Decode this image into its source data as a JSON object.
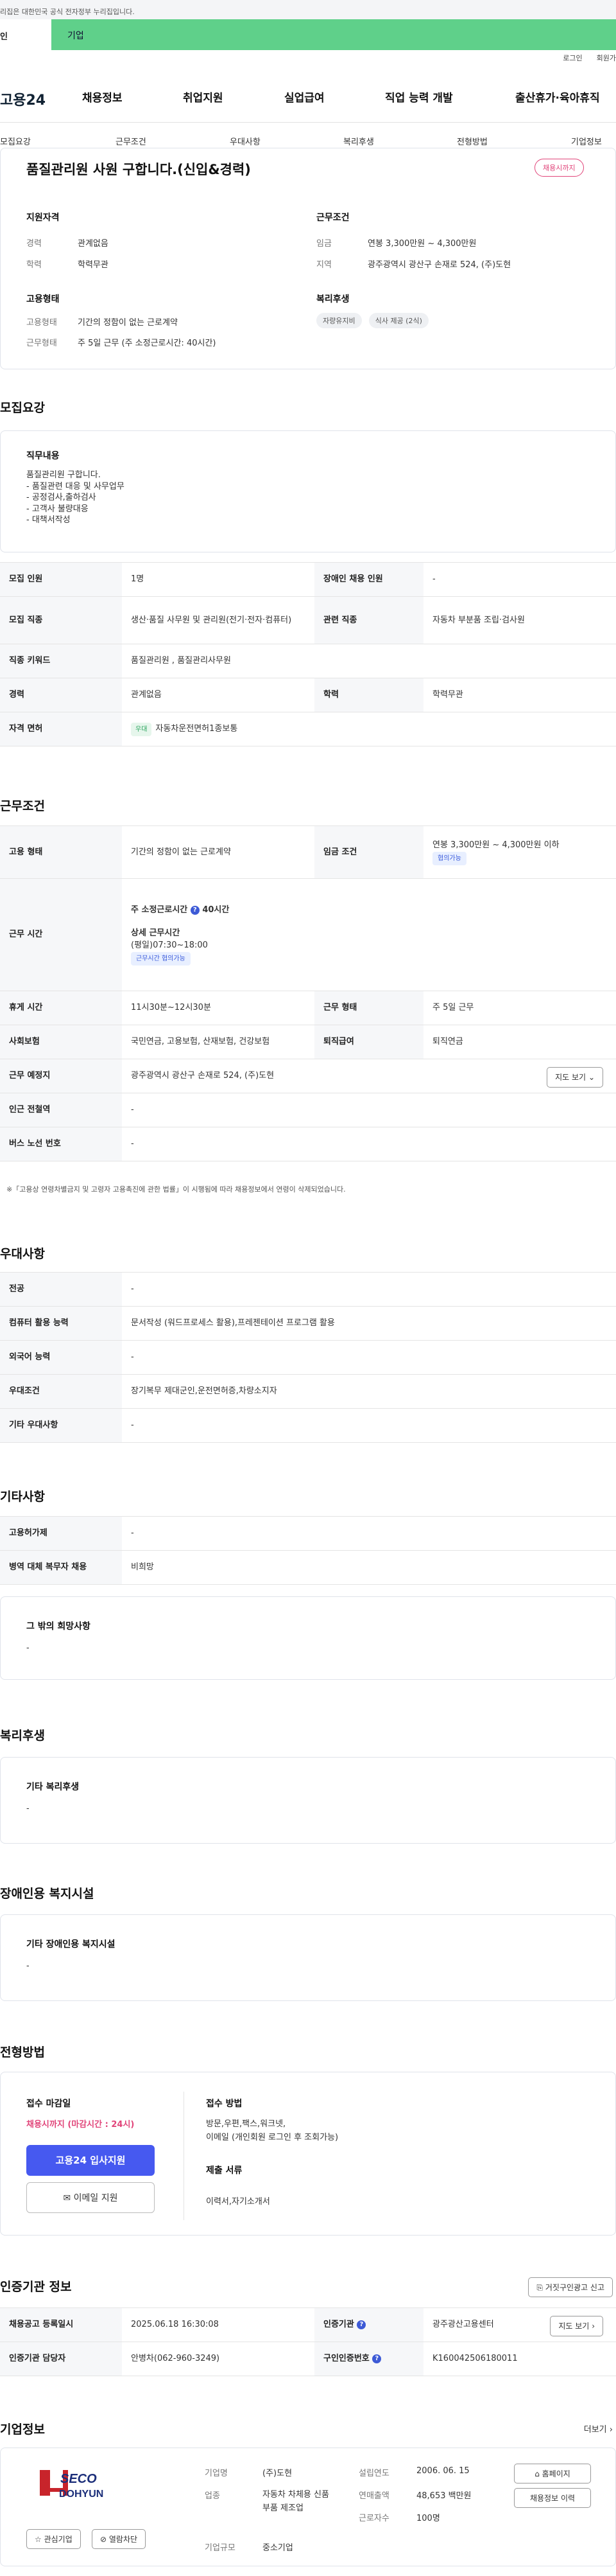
{
  "header": {
    "notice": "리집은 대한민국 공식 전자정부 누리집입니다.",
    "user_tab_personal": "인",
    "user_tab_company": "기업",
    "util_login": "로그인",
    "util_join": "회원가",
    "logo": "고용24",
    "gnb": [
      "채용정보",
      "취업지원",
      "실업급여",
      "직업 능력 개발",
      "출산휴가·육아휴직"
    ],
    "subnav": [
      "모집요강",
      "근무조건",
      "우대사항",
      "복리후생",
      "전형방법",
      "기업정보"
    ]
  },
  "summary": {
    "title": "품질관리원 사원 구합니다.(신입&경력)",
    "status_badge": "채용시까지",
    "qual_title": "지원자격",
    "career_label": "경력",
    "career_value": "관계없음",
    "edu_label": "학력",
    "edu_value": "학력무관",
    "cond_title": "근무조건",
    "wage_label": "임금",
    "wage_value": "연봉 3,300만원 ~ 4,300만원",
    "region_label": "지역",
    "region_value": "광주광역시 광산구 손재로 524, (주)도현",
    "emp_title": "고용형태",
    "emptype_label": "고용형태",
    "emptype_value": "기간의 정함이 없는 근로계약",
    "worktype_label": "근무형태",
    "worktype_value": "주 5일 근무 (주 소정근로시간: 40시간)",
    "welfare_title": "복리후생",
    "welfare_chips": [
      "자량유지비",
      "식사 제공 (2식)"
    ]
  },
  "recruit": {
    "title": "모집요강",
    "duty_title": "직무내용",
    "duty_text": "품질관리원 구합니다.\n - 품질관련 대응 및 사무업무\n - 공정검사,출하검사\n - 고객사 불량대응\n - 대책서작성",
    "rows": {
      "count_label": "모집 인원",
      "count_value": "1명",
      "disabled_label": "장애인 채용 인원",
      "disabled_value": "-",
      "job_label": "모집 직종",
      "job_value": "생산·품질 사무원 및 관리원(전기·전자·컴퓨터)",
      "rel_label": "관련 직종",
      "rel_value": "자동차 부분품 조립·검사원",
      "kw_label": "직종 키워드",
      "kw_value": "품질관리원 , 품질관리사무원",
      "career_label": "경력",
      "career_value": "관계없음",
      "edu_label": "학력",
      "edu_value": "학력무관",
      "license_label": "자격 면허",
      "license_chip": "우대",
      "license_value": "자동차운전면허1종보통"
    }
  },
  "conditions": {
    "title": "근무조건",
    "emptype_label": "고용 형태",
    "emptype_value": "기간의 정함이 없는 근로계약",
    "wage_label": "임금 조건",
    "wage_value": "연봉 3,300만원 ~ 4,300만원 이하",
    "wage_chip": "협의가능",
    "hours_label": "근무 시간",
    "hours_weekly": "주 소정근로시간",
    "hours_weekly_value": "40시간",
    "hours_detail_title": "상세 근무시간",
    "hours_detail": "(평일)07:30~18:00",
    "hours_chip": "근무시간 협의가능",
    "break_label": "휴게 시간",
    "break_value": "11시30분~12시30분",
    "worktype_label": "근무 형태",
    "worktype_value": "주 5일 근무",
    "insurance_label": "사회보험",
    "insurance_value": "국민연금, 고용보험, 산재보험, 건강보험",
    "retire_label": "퇴직급여",
    "retire_value": "퇴직연금",
    "place_label": "근무 예정지",
    "place_value": "광주광역시 광산구 손재로 524, (주)도현",
    "map_btn": "지도 보기",
    "subway_label": "인근 전철역",
    "subway_value": "-",
    "bus_label": "버스 노선 번호",
    "bus_value": "-",
    "footnote": "※「고용상 연령차별금지 및 고령자 고용촉진에 관한 법률」이 시행됨에 따라 채용정보에서 연령이 삭제되었습니다."
  },
  "preferences": {
    "title": "우대사항",
    "major_label": "전공",
    "major_value": "-",
    "computer_label": "컴퓨터 활용 능력",
    "computer_value": "문서작성 (워드프로세스 활용),프레젠테이션 프로그램 활용",
    "lang_label": "외국어 능력",
    "lang_value": "-",
    "pref_label": "우대조건",
    "pref_value": "장기복무 제대군인,운전면허증,차량소지자",
    "etc_label": "기타 우대사항",
    "etc_value": "-"
  },
  "others": {
    "title": "기타사항",
    "insurance_label": "고용허가제",
    "insurance_value": "-",
    "military_label": "병역 대체 복무자 채용",
    "military_value": "비희망",
    "wish_title": "그 밖의 희망사항",
    "wish_value": "-"
  },
  "welfare": {
    "title": "복리후생",
    "box_title": "기타 복리후생",
    "box_value": "-"
  },
  "disabled": {
    "title": "장애인용 복지시설",
    "box_title": "기타 장애인용 복지시설",
    "box_value": "-"
  },
  "selection": {
    "title": "전형방법",
    "deadline_title": "접수 마감일",
    "deadline_value": "채용시까지 (마감시간 : 24시)",
    "apply_btn": "고용24 입사지원",
    "email_btn": "이메일 지원",
    "method_title": "접수 방법",
    "method_value": "방문,우편,팩스,워크넷,\n이메일 (개인회원 로그인 후 조회가능)",
    "docs_title": "제출 서류",
    "docs_value": "이력서,자기소개서"
  },
  "agency": {
    "title": "인증기관 정보",
    "report_btn": "거짓구인광고 신고",
    "reg_label": "채용공고 등록일시",
    "reg_value": "2025.06.18 16:30:08",
    "agency_label": "인증기관",
    "agency_value": "광주광산고용센터",
    "map_btn": "지도 보기",
    "staff_label": "인증기관 담당자",
    "staff_value": "안병차(062-960-3249)",
    "id_label": "구인인증번호",
    "id_value": "K160042506180011"
  },
  "company": {
    "title": "기업정보",
    "more": "더보기",
    "logo_top": "SECO",
    "logo_bottom": "DOHYUN",
    "fav_btn": "관심기업",
    "block_btn": "열람차단",
    "name_label": "기업명",
    "name_value": "(주)도현",
    "industry_label": "업종",
    "industry_value": "자동차 차체용 신품 부품 제조업",
    "size_label": "기업규모",
    "size_value": "중소기업",
    "founded_label": "설립연도",
    "founded_value": "2006. 06. 15",
    "sales_label": "연매출액",
    "sales_value": "48,653 백만원",
    "staff_label": "근로자수",
    "staff_value": "100명",
    "home_btn": "홈페이지",
    "jobs_btn": "채용정보 이력"
  }
}
